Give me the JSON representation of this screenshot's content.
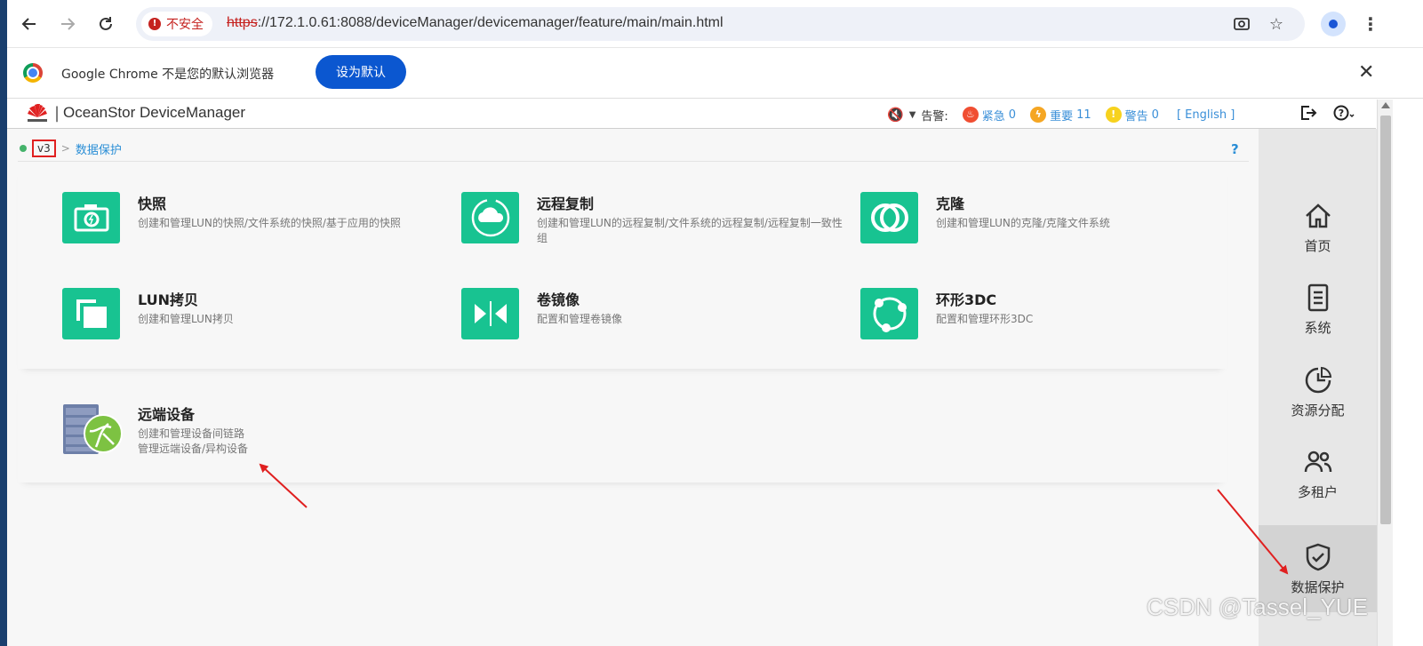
{
  "browser": {
    "security_label": "不安全",
    "url_scheme": "https",
    "url_rest": "://172.1.0.61:8088/deviceManager/devicemanager/feature/main/main.html",
    "infobar_text": "Google Chrome 不是您的默认浏览器",
    "set_default_label": "设为默认"
  },
  "app": {
    "title": "OceanStor DeviceManager",
    "alarm_label": "告警:",
    "alarms": [
      {
        "label": "紧急",
        "count": "0",
        "color": "#f04e32"
      },
      {
        "label": "重要",
        "count": "11",
        "color": "#f5a623"
      },
      {
        "label": "警告",
        "count": "0",
        "color": "#f7d21e"
      }
    ],
    "language": "[ English ]"
  },
  "breadcrumb": {
    "home": "v3",
    "current": "数据保护",
    "help": "?"
  },
  "features": [
    {
      "title": "快照",
      "desc": "创建和管理LUN的快照/文件系统的快照/基于应用的快照",
      "icon": "camera-icon"
    },
    {
      "title": "远程复制",
      "desc": "创建和管理LUN的远程复制/文件系统的远程复制/远程复制一致性组",
      "icon": "cloud-sync-icon"
    },
    {
      "title": "克隆",
      "desc": "创建和管理LUN的克隆/克隆文件系统",
      "icon": "clone-rings-icon"
    },
    {
      "title": "LUN拷贝",
      "desc": "创建和管理LUN拷贝",
      "icon": "copy-squares-icon"
    },
    {
      "title": "卷镜像",
      "desc": "配置和管理卷镜像",
      "icon": "mirror-icon"
    },
    {
      "title": "环形3DC",
      "desc": "配置和管理环形3DC",
      "icon": "ring-3dc-icon"
    }
  ],
  "remote_device": {
    "title": "远端设备",
    "desc_line1": "创建和管理设备间链路",
    "desc_line2": "管理远端设备/异构设备",
    "icon": "server-globe-icon"
  },
  "right_nav": [
    {
      "label": "首页",
      "icon": "home-icon",
      "active": false
    },
    {
      "label": "系统",
      "icon": "system-doc-icon",
      "active": false
    },
    {
      "label": "资源分配",
      "icon": "resource-chart-icon",
      "active": false
    },
    {
      "label": "多租户",
      "icon": "tenants-icon",
      "active": false
    },
    {
      "label": "数据保护",
      "icon": "shield-check-icon",
      "active": true
    }
  ],
  "watermark": "CSDN @Tassel_YUE",
  "colors": {
    "feature_green": "#18c391",
    "link_blue": "#2a8ed6",
    "annotation_red": "#e02020"
  }
}
